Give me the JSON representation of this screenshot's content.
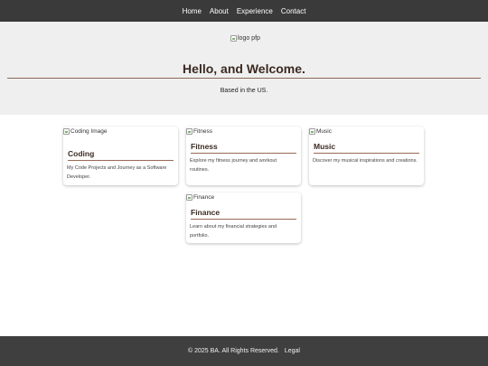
{
  "nav": {
    "items": [
      "Home",
      "About",
      "Experience",
      "Contact"
    ]
  },
  "hero": {
    "logo_alt": "logo pfp",
    "title": "Hello, and Welcome.",
    "subtitle": "Based in the US."
  },
  "cards": [
    {
      "img_alt": "Coding Image",
      "title": "Coding",
      "description": "My Code Projects and Journey as a Software Developer."
    },
    {
      "img_alt": "Fitness",
      "title": "Fitness",
      "description": "Explore my fitness journey and workout routines."
    },
    {
      "img_alt": "Music",
      "title": "Music",
      "description": "Discover my musical inspirations and creations."
    },
    {
      "img_alt": "Finance",
      "title": "Finance",
      "description": "Learn about my financial strategies and portfolio."
    }
  ],
  "footer": {
    "copyright": "© 2025 BA. All Rights Reserved.",
    "legal_link": "Legal"
  },
  "colors": {
    "nav_bg": "#3a3a3a",
    "hero_bg": "#efefef",
    "accent": "#8a6a55",
    "footer_bg": "#3f3f3f"
  }
}
